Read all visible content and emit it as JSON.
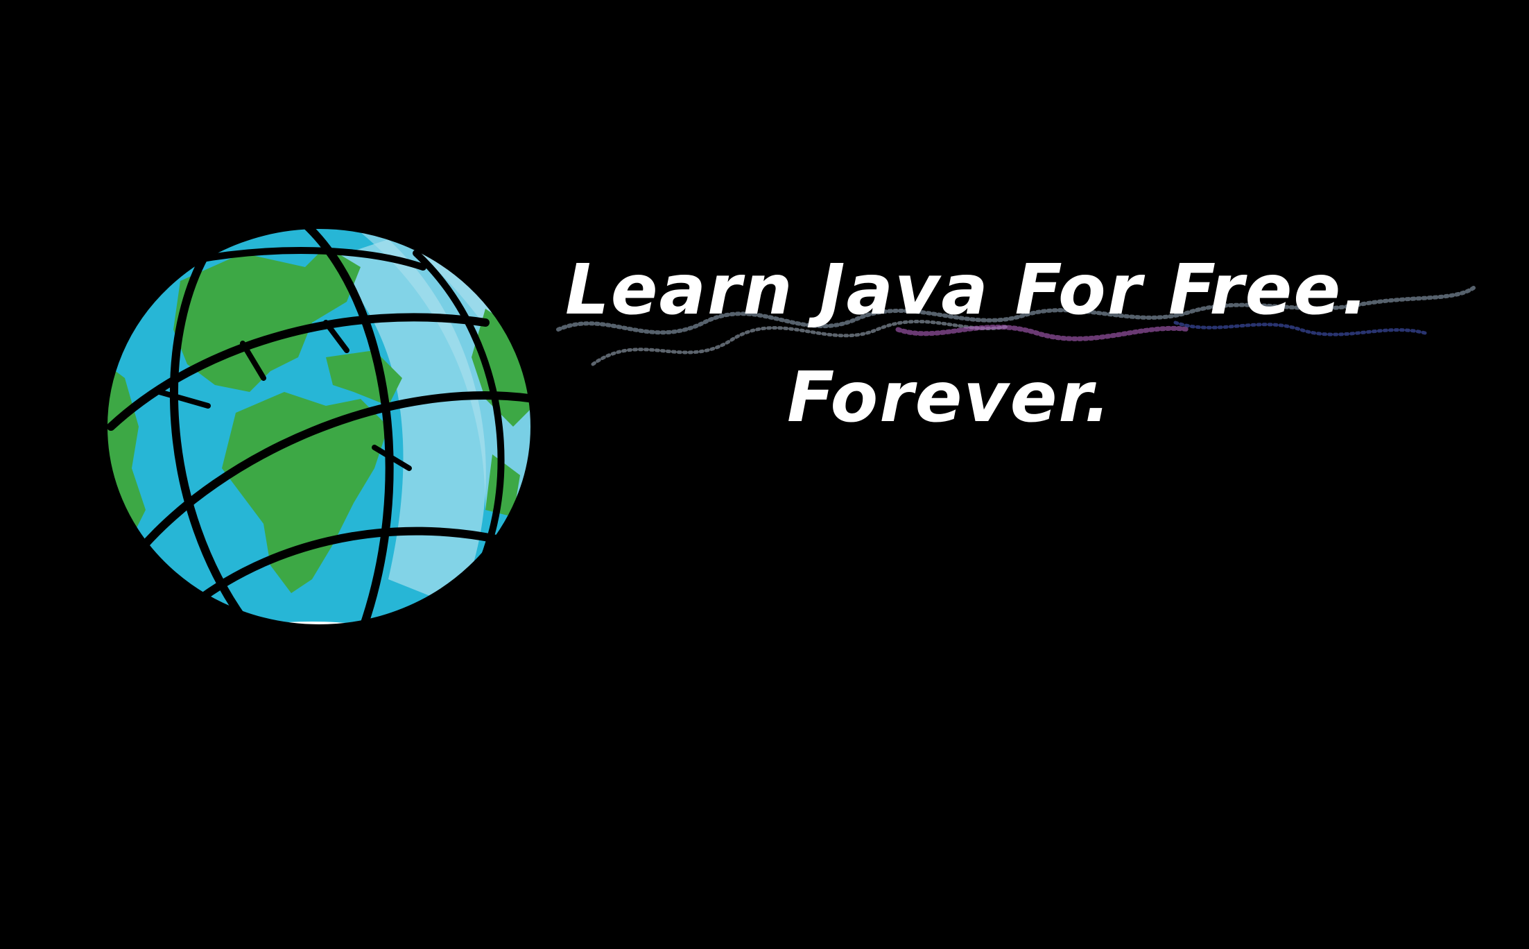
{
  "banner": {
    "headline_line_1": "Learn Java For Free.",
    "headline_line_2": "Forever."
  },
  "globe": {
    "icon": "globe-icon",
    "ocean_color": "#27b6d6",
    "light_ocean_color": "#8fd6e8",
    "land_color": "#3da845",
    "outline_color": "#000000"
  },
  "colors": {
    "background": "#000000",
    "text": "#ffffff"
  }
}
